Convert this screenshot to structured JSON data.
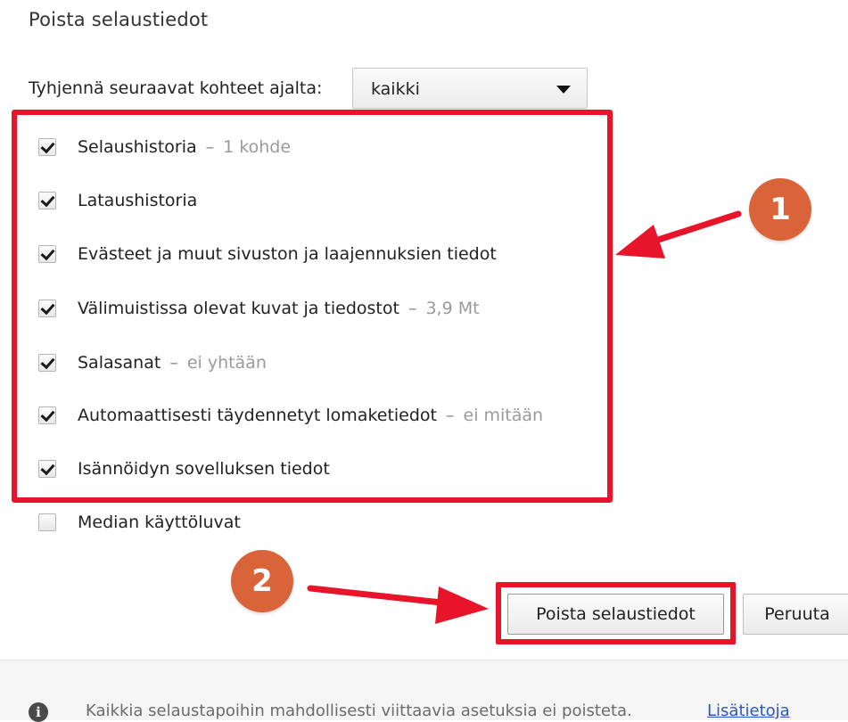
{
  "dialog": {
    "title": "Poista selaustiedot",
    "range_label": "Tyhjennä seuraavat kohteet ajalta:",
    "range_value": "kaikki"
  },
  "items": [
    {
      "label": "Selaushistoria",
      "sep": "–",
      "detail": "1 kohde",
      "checked": true
    },
    {
      "label": "Lataushistoria",
      "sep": "",
      "detail": "",
      "checked": true
    },
    {
      "label": "Evästeet ja muut sivuston ja laajennuksien tiedot",
      "sep": "",
      "detail": "",
      "checked": true
    },
    {
      "label": "Välimuistissa olevat kuvat ja tiedostot",
      "sep": "–",
      "detail": "3,9 Mt",
      "checked": true
    },
    {
      "label": "Salasanat",
      "sep": "–",
      "detail": "ei yhtään",
      "checked": true
    },
    {
      "label": "Automaattisesti täydennetyt lomaketiedot",
      "sep": "–",
      "detail": "ei mitään",
      "checked": true
    },
    {
      "label": "Isännöidyn sovelluksen tiedot",
      "sep": "",
      "detail": "",
      "checked": true
    },
    {
      "label": "Median käyttöluvat",
      "sep": "",
      "detail": "",
      "checked": false
    }
  ],
  "buttons": {
    "clear_label": "Poista selaustiedot",
    "cancel_label": "Peruuta"
  },
  "footer": {
    "info_glyph": "i",
    "text": "Kaikkia selaustapoihin mahdollisesti viittaavia asetuksia ei poisteta.",
    "link": "Lisätietoja"
  },
  "annotations": {
    "badge_1": "1",
    "badge_2": "2",
    "highlight_color": "#e8152a",
    "badge_color": "#d9643a"
  }
}
